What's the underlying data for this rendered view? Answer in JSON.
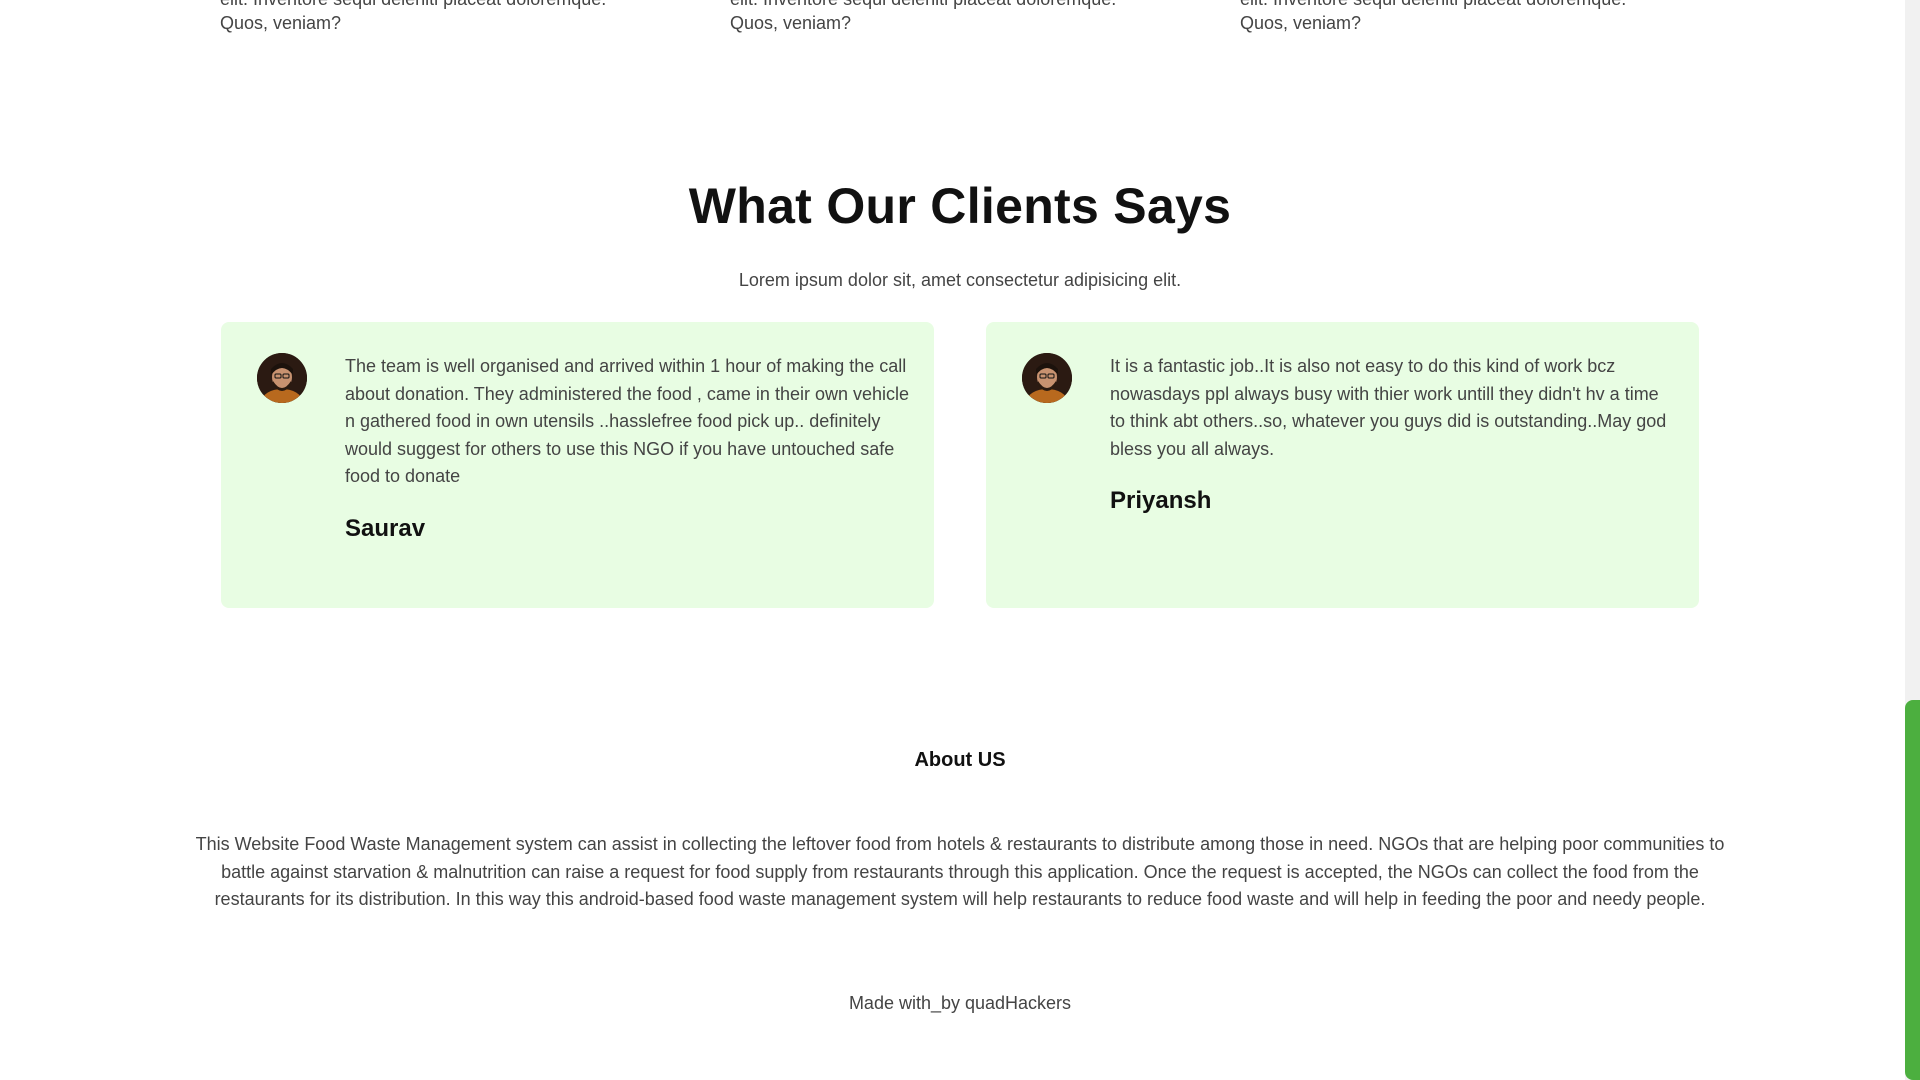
{
  "services": {
    "items": [
      {
        "line1": "elit. Inventore sequi deleniti placeat doloremque.",
        "line2": "Quos, veniam?"
      },
      {
        "line1": "elit. Inventore sequi deleniti placeat doloremque.",
        "line2": "Quos, veniam?"
      },
      {
        "line1": "elit. Inventore sequi deleniti placeat doloremque.",
        "line2": "Quos, veniam?"
      }
    ]
  },
  "testimonials": {
    "title": "What Our Clients Says",
    "subtitle": "Lorem ipsum dolor sit, amet consectetur adipisicing elit.",
    "items": [
      {
        "text": "The team is well organised and arrived within 1 hour of making the call about donation. They administered the food , came in their own vehicle n gathered food in own utensils ..hasslefree food pick up.. definitely would suggest for others to use this NGO if you have untouched safe food to donate",
        "name": "Saurav"
      },
      {
        "text": "It is a fantastic job..It is also not easy to do this kind of work bcz nowasdays ppl always busy with thier work untill they didn't hv a time to think abt others..so, whatever you guys did is outstanding..May god bless you all always.",
        "name": "Priyansh"
      }
    ]
  },
  "about": {
    "title": "About US",
    "text": "This Website Food Waste Management system can assist in collecting the leftover food from hotels & restaurants to distribute among those in need. NGOs that are helping poor communities to battle against starvation & malnutrition can raise a request for food supply from restaurants through this application. Once the request is accepted, the NGOs can collect the food from the restaurants for its distribution. In this way this android-based food waste management system will help restaurants to reduce food waste and will help in feeding the poor and needy people."
  },
  "footer": {
    "credit": "Made with_by quadHackers"
  },
  "colors": {
    "card_background": "#e8fde3",
    "scroll_thumb": "#4caf3f"
  },
  "icons": {
    "avatar": "avatar-icon"
  }
}
